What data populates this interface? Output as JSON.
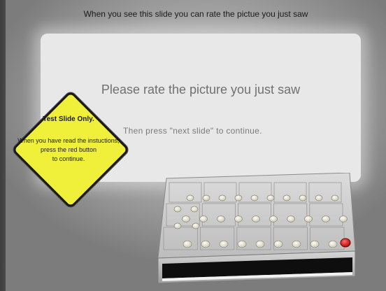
{
  "header": {
    "text": "When you see this slide you can rate the pictue you just saw"
  },
  "screen": {
    "title": "Please rate the picture you just saw",
    "subtitle": "Then press \"next slide\" to continue."
  },
  "sign": {
    "title": "Test Slide Only.",
    "body_lines": [
      "When you have read the instuctions,",
      "press the red button",
      "to continue."
    ]
  },
  "device": {
    "red_button_color": "#e01a1a",
    "panel_color": "#cfcfcf",
    "button_color": "#e6e3d6"
  }
}
